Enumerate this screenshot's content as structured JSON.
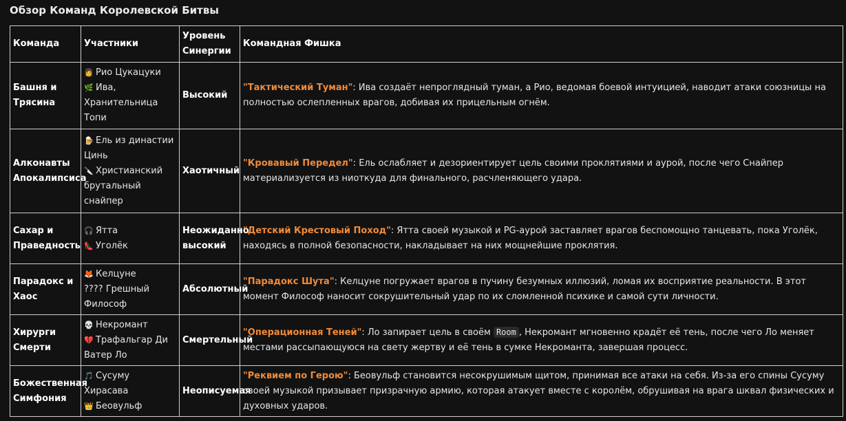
{
  "title": "Обзор Команд Королевской Битвы",
  "headers": {
    "team": "Команда",
    "members": "Участники",
    "synergy": "Уровень Синергии",
    "feature": "Командная Фишка"
  },
  "rows": [
    {
      "team": "Башня и Трясина",
      "members": [
        {
          "icon": "👩",
          "name": "Рио Цукацуки"
        },
        {
          "icon": "🌿",
          "name": "Ива, Хранительница Топи"
        }
      ],
      "synergy": "Высокий",
      "feature_name": "\"Тактический Туман\"",
      "feature_pre": ": Ива создаёт непроглядный туман, а Рио, ведомая боевой интуицией, наводит атаки союзницы на полностью ослепленных врагов, добивая их прицельным огнём.",
      "code": "",
      "feature_post": ""
    },
    {
      "team": "Алконавты Апокалипсиса",
      "members": [
        {
          "icon": "🍺",
          "name": "Ель из династии Цинь"
        },
        {
          "icon": "🔪",
          "name": "Христианский брутальный снайпер"
        }
      ],
      "synergy": "Хаотичный",
      "feature_name": "\"Кровавый Передел\"",
      "feature_pre": ": Ель ослабляет и дезориентирует цель своими проклятиями и аурой, после чего Снайпер материализуется из ниоткуда для финального, расчленяющего удара.",
      "code": "",
      "feature_post": ""
    },
    {
      "team": "Сахар и Праведность",
      "members": [
        {
          "icon": "🎧",
          "name": "Ятта"
        },
        {
          "icon": "👠",
          "name": "Уголёк"
        }
      ],
      "synergy": "Неожиданно высокий",
      "feature_name": "\"Детский Крестовый Поход\"",
      "feature_pre": ": Ятта своей музыкой и PG-аурой заставляет врагов беспомощно танцевать, пока Уголёк, находясь в полной безопасности, накладывает на них мощнейшие проклятия.",
      "code": "",
      "feature_post": ""
    },
    {
      "team": "Парадокс и Хаос",
      "members": [
        {
          "icon": "🦊",
          "name": "Келцуне"
        },
        {
          "icon": "",
          "name": "???? Грешный Философ"
        }
      ],
      "synergy": "Абсолютный",
      "feature_name": "\"Парадокс Шута\"",
      "feature_pre": ": Келцуне погружает врагов в пучину безумных иллюзий, ломая их восприятие реальности. В этот момент Философ наносит сокрушительный удар по их сломленной психике и самой сути личности.",
      "code": "",
      "feature_post": ""
    },
    {
      "team": "Хирурги Смерти",
      "members": [
        {
          "icon": "💀",
          "name": "Некромант"
        },
        {
          "icon": "💔",
          "name": "Трафальгар Ди Ватер Ло"
        }
      ],
      "synergy": "Смертельный",
      "feature_name": "\"Операционная Теней\"",
      "feature_pre": ": Ло запирает цель в своём ",
      "code": "Room",
      "feature_post": ", Некромант мгновенно крадёт её тень, после чего Ло меняет местами рассыпающуюся на свету жертву и её тень в сумке Некроманта, завершая процесс."
    },
    {
      "team": "Божественная Симфония",
      "members": [
        {
          "icon": "🎵",
          "name": "Сусуму Хирасава"
        },
        {
          "icon": "👑",
          "name": "Беовульф"
        }
      ],
      "synergy": "Неописуемая",
      "feature_name": "\"Реквием по Герою\"",
      "feature_pre": ": Беовульф становится несокрушимым щитом, принимая все атаки на себя. Из-за его спины Сусуму своей музыкой призывает призрачную армию, которая атакует вместе с королём, обрушивая на врага шквал физических и духовных ударов.",
      "code": "",
      "feature_post": ""
    }
  ]
}
